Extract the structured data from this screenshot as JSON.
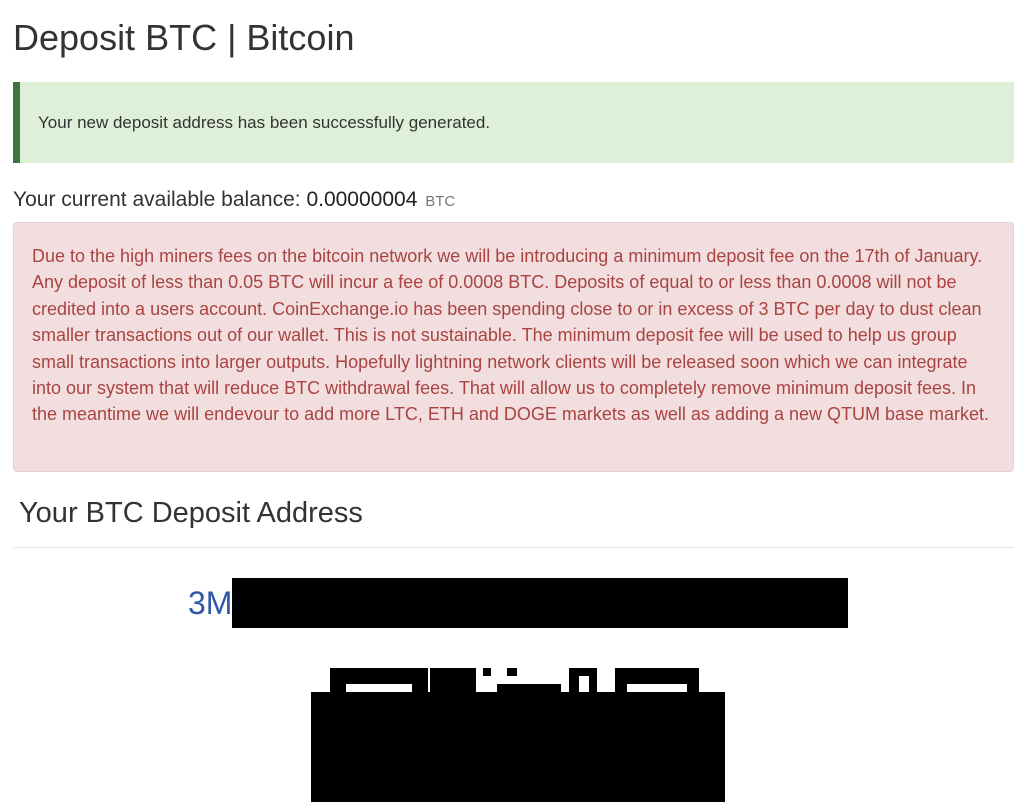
{
  "page": {
    "title": "Deposit BTC | Bitcoin"
  },
  "alerts": {
    "success_message": "Your new deposit address has been successfully generated.",
    "fee_notice": "Due to the high miners fees on the bitcoin network we will be introducing a minimum deposit fee on the 17th of January. Any deposit of less than 0.05 BTC will incur a fee of 0.0008 BTC. Deposits of equal to or less than 0.0008 will not be credited into a users account. CoinExchange.io has been spending close to or in excess of 3 BTC per day to dust clean smaller transactions out of our wallet. This is not sustainable. The minimum deposit fee will be used to help us group small transactions into larger outputs. Hopefully lightning network clients will be released soon which we can integrate into our system that will reduce BTC withdrawal fees. That will allow us to completely remove minimum deposit fees. In the meantime we will endevour to add more LTC, ETH and DOGE markets as well as adding a new QTUM base market."
  },
  "balance": {
    "label": "Your current available balance:",
    "value": "0.00000004",
    "unit": "BTC"
  },
  "deposit": {
    "heading": "Your BTC Deposit Address",
    "address_visible_prefix": "3M"
  },
  "colors": {
    "success_bg": "#dff0d8",
    "success_border": "#3c763d",
    "danger_bg": "#f2dede",
    "danger_text": "#a94442",
    "link_blue": "#2f59a6"
  },
  "icons": {
    "qr_code": "qr-code-icon"
  }
}
